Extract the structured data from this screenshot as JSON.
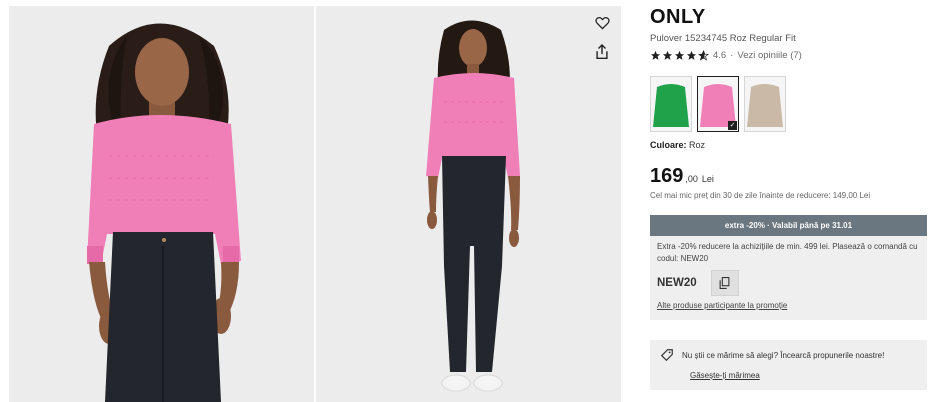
{
  "gallery": {
    "images": [
      {
        "icon": "model-front-closeup-photo"
      },
      {
        "icon": "model-full-body-photo"
      }
    ],
    "favorite_icon": "heart-icon",
    "share_icon": "share-icon"
  },
  "product": {
    "brand": "ONLY",
    "subtitle": "Pulover 15234745 Roz Regular Fit",
    "rating": {
      "stars": 4.6,
      "value": "4.6",
      "separator": "·",
      "reviews_link": "Vezi opiniile (7)"
    },
    "swatches": [
      {
        "name": "green",
        "color": "#1fa24a",
        "selected": false
      },
      {
        "name": "pink",
        "color": "#f07fb8",
        "selected": true
      },
      {
        "name": "beige",
        "color": "#c9b9a6",
        "selected": false
      }
    ],
    "color_label": "Culoare:",
    "color_value": "Roz",
    "price": {
      "integer": "169",
      "decimals": ",00",
      "currency": "Lei",
      "note": "Cel mai mic preț din 30 de zile înainte de reducere: 149,00 Lei"
    }
  },
  "promo": {
    "banner": "extra -20% · Valabil până pe 31.01",
    "description": "Extra -20% reducere la achizițiile de min. 499 lei. Plasează o comandă cu codul: NEW20",
    "code": "NEW20",
    "link": "Alte produse participante la promoție",
    "banner_color": "#6a7680"
  },
  "size_help": {
    "text": "Nu știi ce mărime să alegi? Încearcă propunerile noastre!",
    "link": "Găsește-ți mărimea"
  },
  "colors": {
    "sweater_pink": "#f07fb8",
    "jeans_dark": "#23262d",
    "background_gray": "#eeeeee"
  }
}
